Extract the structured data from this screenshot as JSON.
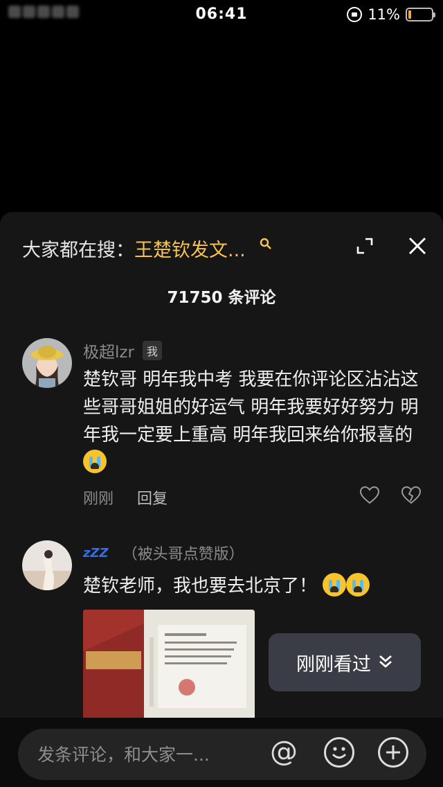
{
  "status_bar": {
    "time": "06:41",
    "battery_percent": "11%",
    "battery_level": 0.11
  },
  "panel": {
    "search_prefix": "大家都在搜：",
    "search_term": "王楚钦发文...",
    "comment_count": "71750 条评论"
  },
  "comments": [
    {
      "username": "极超lzr",
      "badge": "我",
      "text": "楚钦哥 明年我中考 我要在你评论区沾沾这些哥哥姐姐的好运气 明年我要好好努力 明年我一定要上重高 明年我回来给你报喜的",
      "emoji": "loudly-crying-face",
      "time": "刚刚",
      "reply_label": "回复"
    },
    {
      "username": "（被头哥点赞版）",
      "text": "楚钦老师，我也要去北京了！",
      "emoji": "loudly-crying-face"
    }
  ],
  "recent_button": {
    "label": "刚刚看过"
  },
  "input_bar": {
    "placeholder": "发条评论，和大家一..."
  },
  "colors": {
    "accent": "#f6c453",
    "panel_bg": "#161616",
    "button_bg": "#3a3d45"
  }
}
